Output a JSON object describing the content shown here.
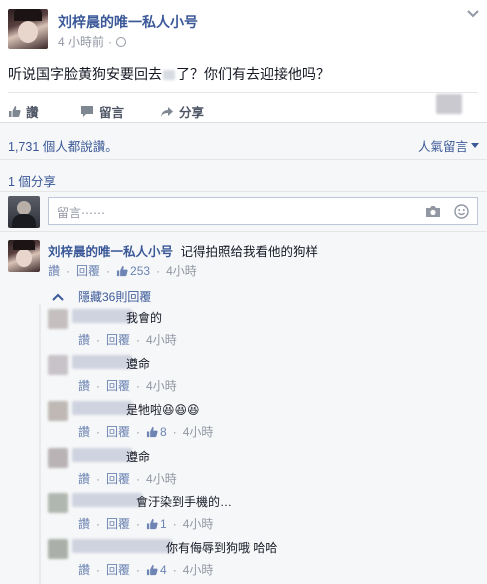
{
  "post": {
    "author": "刘梓晨的唯一私人小号",
    "time": "4 小時前",
    "dot": "·",
    "text": "听说国字脸黄狗安要回去",
    "text_tail": "了？你们有去迎接他吗？"
  },
  "actions": {
    "like": "讚",
    "comment": "留言",
    "share": "分享"
  },
  "stats": {
    "likes": "1,731 個人都說讚。",
    "sort": "人氣留言",
    "shares": "1 個分享"
  },
  "composer": {
    "placeholder": "留言⋯⋯"
  },
  "top_comment": {
    "author": "刘梓晨的唯一私人小号",
    "text": "记得拍照给我看他的狗样",
    "like": "讚",
    "reply": "回覆",
    "likes": "253",
    "time": "4小時",
    "hide_label": "隱藏36則回覆"
  },
  "replies": [
    {
      "text": "我會的",
      "like": "讚",
      "reply": "回覆",
      "likes": "",
      "time": "4小時"
    },
    {
      "text": "遵命",
      "like": "讚",
      "reply": "回覆",
      "likes": "",
      "time": "4小時"
    },
    {
      "text": "是牠啦😆😆😆",
      "like": "讚",
      "reply": "回覆",
      "likes": "8",
      "time": "4小時"
    },
    {
      "text": "遵命",
      "like": "讚",
      "reply": "回覆",
      "likes": "",
      "time": "4小時"
    },
    {
      "text": "會汙染到手機的…",
      "like": "讚",
      "reply": "回覆",
      "likes": "1",
      "time": "4小時"
    },
    {
      "text": "你有侮辱到狗哦 哈哈",
      "like": "讚",
      "reply": "回覆",
      "likes": "4",
      "time": "4小時"
    }
  ],
  "colors": {
    "link": "#3b5998",
    "muted": "#9197a3",
    "action": "#4e5665"
  }
}
